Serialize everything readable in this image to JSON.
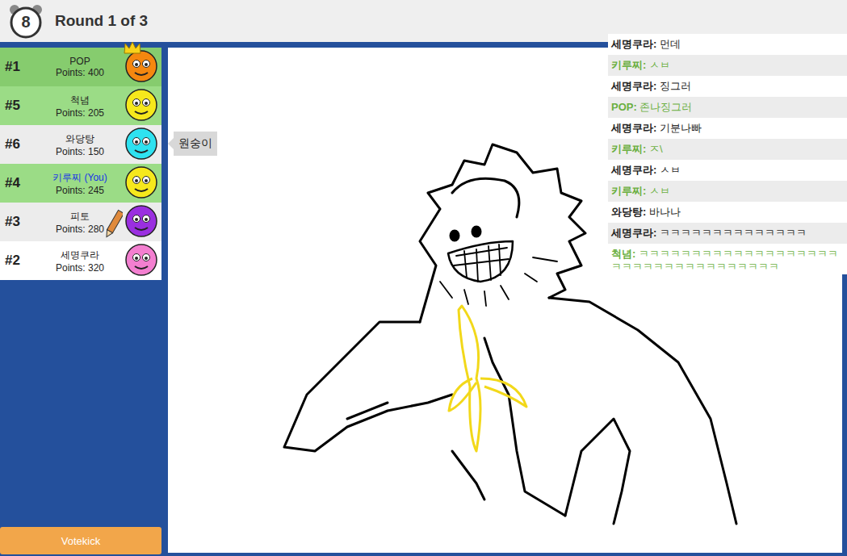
{
  "header": {
    "timer": "8",
    "round": "Round 1 of 3"
  },
  "players": [
    {
      "rank": "#1",
      "name": "POP",
      "points": "Points: 400",
      "guessed": true,
      "you": false,
      "drawing": false,
      "crown": true,
      "color": "#f5870f",
      "tooltip": ""
    },
    {
      "rank": "#5",
      "name": "척념",
      "points": "Points: 205",
      "guessed": true,
      "you": false,
      "drawing": false,
      "crown": false,
      "color": "#f6e81c",
      "tooltip": ""
    },
    {
      "rank": "#6",
      "name": "와당탕",
      "points": "Points: 150",
      "guessed": false,
      "you": false,
      "drawing": false,
      "crown": false,
      "color": "#2ee2f0",
      "tooltip": "원숭이"
    },
    {
      "rank": "#4",
      "name": "키루찌 (You)",
      "points": "Points: 245",
      "guessed": true,
      "you": true,
      "drawing": false,
      "crown": false,
      "color": "#f6e81c",
      "tooltip": ""
    },
    {
      "rank": "#3",
      "name": "피토",
      "points": "Points: 280",
      "guessed": false,
      "you": false,
      "drawing": true,
      "crown": false,
      "color": "#9a2fe0",
      "tooltip": ""
    },
    {
      "rank": "#2",
      "name": "세명쿠라",
      "points": "Points: 320",
      "guessed": false,
      "you": false,
      "drawing": false,
      "crown": false,
      "color": "#f37fd0",
      "tooltip": ""
    }
  ],
  "chat": [
    {
      "name": "세명쿠라",
      "text": "먼데",
      "guessed": false
    },
    {
      "name": "키루찌",
      "text": "ㅅㅂ",
      "guessed": true
    },
    {
      "name": "세명쿠라",
      "text": "징그러",
      "guessed": false
    },
    {
      "name": "POP",
      "text": "존나징그러",
      "guessed": true
    },
    {
      "name": "세명쿠라",
      "text": "기분나빠",
      "guessed": false
    },
    {
      "name": "키루찌",
      "text": "ㅈ\\",
      "guessed": true
    },
    {
      "name": "세명쿠라",
      "text": "ㅅㅂ",
      "guessed": false
    },
    {
      "name": "키루찌",
      "text": "ㅅㅂ",
      "guessed": true
    },
    {
      "name": "와당탕",
      "text": "바나나",
      "guessed": false
    },
    {
      "name": "세명쿠라",
      "text": "ㅋㅋㅋㅋㅋㅋㅋㅋㅋㅋㅋㅋㅋㅋ",
      "guessed": false
    },
    {
      "name": "척념",
      "text": "ㅋㅋㅋㅋㅋㅋㅋㅋㅋㅋㅋㅋㅋㅋㅋㅋㅋㅋㅋㅋㅋㅋㅋㅋㅋㅋㅋㅋㅋㅋㅋㅋㅋㅋㅋ",
      "guessed": true
    }
  ],
  "votekick": "Votekick"
}
